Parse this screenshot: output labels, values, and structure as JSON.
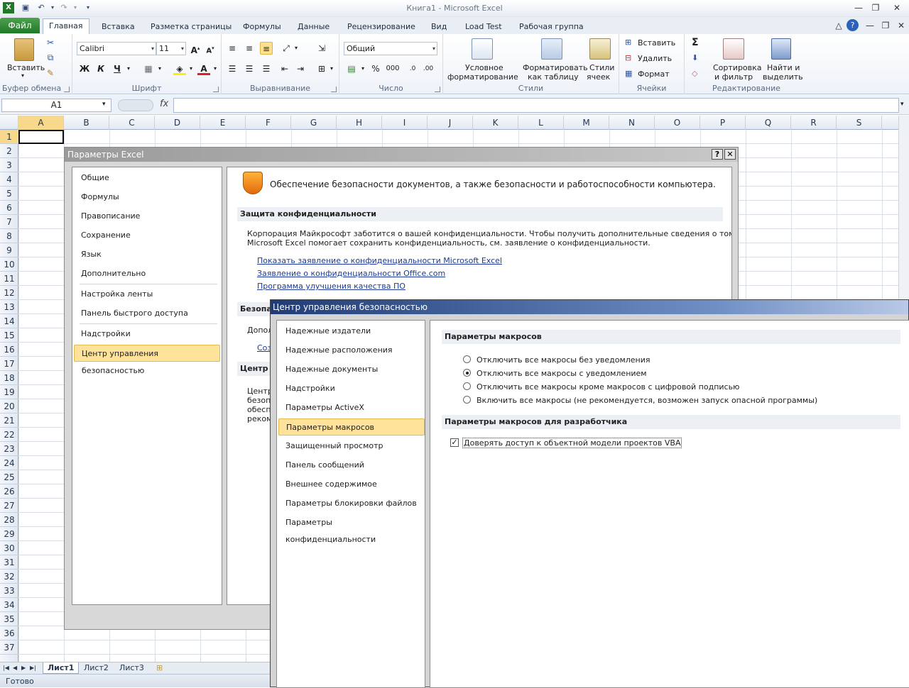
{
  "titlebar": {
    "title": "Книга1  -  Microsoft Excel"
  },
  "ribbon_tabs": {
    "file": "Файл",
    "tabs": [
      "Главная",
      "Вставка",
      "Разметка страницы",
      "Формулы",
      "Данные",
      "Рецензирование",
      "Вид",
      "Load Test",
      "Рабочая группа"
    ]
  },
  "ribbon": {
    "clipboard": {
      "paste": "Вставить",
      "label": "Буфер обмена"
    },
    "font": {
      "name": "Calibri",
      "size": "11",
      "label": "Шрифт",
      "bold": "Ж",
      "italic": "К",
      "underline": "Ч"
    },
    "alignment": {
      "label": "Выравнивание"
    },
    "number": {
      "format": "Общий",
      "percent": "%",
      "thousands": "000",
      "label": "Число"
    },
    "styles": {
      "conditional": "Условное\nформатирование",
      "conditional_1": "Условное",
      "conditional_2": "форматирование",
      "table_1": "Форматировать",
      "table_2": "как таблицу",
      "cell_1": "Стили",
      "cell_2": "ячеек",
      "label": "Стили"
    },
    "cells": {
      "insert": "Вставить",
      "delete": "Удалить",
      "format": "Формат",
      "label": "Ячейки"
    },
    "editing": {
      "sum": "Σ",
      "sort_1": "Сортировка",
      "sort_2": "и фильтр",
      "find_1": "Найти и",
      "find_2": "выделить",
      "label": "Редактирование"
    }
  },
  "formula_bar": {
    "name_box": "A1",
    "fx": "fx",
    "value": ""
  },
  "grid": {
    "columns": [
      "A",
      "B",
      "C",
      "D",
      "E",
      "F",
      "G",
      "H",
      "I",
      "J",
      "K",
      "L",
      "M",
      "N",
      "O",
      "P",
      "Q",
      "R",
      "S"
    ],
    "rows": [
      "1",
      "2",
      "3",
      "4",
      "5",
      "6",
      "7",
      "8",
      "9",
      "10",
      "11",
      "12",
      "13",
      "14",
      "15",
      "16",
      "17",
      "18",
      "19",
      "20",
      "21",
      "22",
      "23",
      "24",
      "25",
      "26",
      "27",
      "28",
      "29",
      "30",
      "31",
      "32",
      "33",
      "34",
      "35",
      "36",
      "37"
    ]
  },
  "sheet_tabs": [
    "Лист1",
    "Лист2",
    "Лист3"
  ],
  "status": {
    "text": "Готово"
  },
  "options_dialog": {
    "title": "Параметры Excel",
    "help": "?",
    "close": "✕",
    "nav": [
      "Общие",
      "Формулы",
      "Правописание",
      "Сохранение",
      "Язык",
      "Дополнительно",
      "Настройка ленты",
      "Панель быстрого доступа",
      "Надстройки",
      "Центр управления безопасностью"
    ],
    "header_text": "Обеспечение безопасности документов, а также безопасности и работоспособности компьютера.",
    "privacy_heading": "Защита конфиденциальности",
    "privacy_text_1": "Корпорация Майкрософт заботится о вашей конфиденциальности. Чтобы получить дополнительные сведения о том, как",
    "privacy_text_2": "Microsoft Excel помогает сохранить конфиденциальность, см. заявление о конфиденциальности.",
    "links": [
      "Показать заявление о конфиденциальности Microsoft Excel",
      "Заявление о конфиденциальности Office.com",
      "Программа улучшения качества ПО"
    ],
    "security_heading_fragment": "Безопа",
    "additional_fragment": "Допол",
    "link_fragment": "Соз",
    "trust_heading_fragment": "Центр у",
    "trust_text_fragments": [
      "Центр",
      "безоп",
      "обесп",
      "реком"
    ]
  },
  "trust_center": {
    "title": "Центр управления безопасностью",
    "nav": [
      "Надежные издатели",
      "Надежные расположения",
      "Надежные документы",
      "Надстройки",
      "Параметры ActiveX",
      "Параметры макросов",
      "Защищенный просмотр",
      "Панель сообщений",
      "Внешнее содержимое",
      "Параметры блокировки файлов",
      "Параметры конфиденциальности"
    ],
    "macro_heading": "Параметры макросов",
    "macro_options": [
      "Отключить все макросы без уведомления",
      "Отключить все макросы с уведомлением",
      "Отключить все макросы кроме макросов с цифровой подписью",
      "Включить все макросы (не рекомендуется, возможен запуск опасной программы)"
    ],
    "selected_option": 1,
    "dev_heading": "Параметры макросов для разработчика",
    "vba_checkbox": "Доверять доступ к объектной модели проектов VBA",
    "vba_checked": true
  }
}
